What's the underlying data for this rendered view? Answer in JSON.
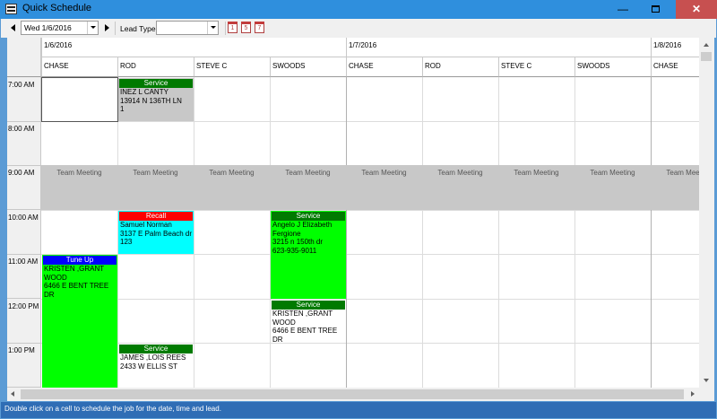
{
  "window": {
    "title": "Quick Schedule",
    "minimize_glyph": "—",
    "close_glyph": "✕"
  },
  "toolbar": {
    "date_value": "Wed 1/6/2016",
    "lead_type_label": "Lead Type",
    "lead_type_value": "",
    "view_buttons": [
      "1",
      "5",
      "7"
    ]
  },
  "dates": [
    "1/6/2016",
    "1/7/2016",
    "1/8/2016"
  ],
  "leads": [
    "CHASE",
    "ROD",
    "STEVE C",
    "SWOODS",
    "CHASE",
    "ROD",
    "STEVE C",
    "SWOODS",
    "CHASE"
  ],
  "times": [
    "7:00 AM",
    "8:00 AM",
    "9:00 AM",
    "10:00 AM",
    "11:00 AM",
    "12:00 PM",
    "1:00 PM"
  ],
  "meeting_label": "Team Meeting",
  "appointments": {
    "a1": {
      "type": "Service",
      "name": "INEZ L CANTY",
      "address": "13914 N 136TH LN",
      "extra": "1"
    },
    "a2": {
      "type": "Recall",
      "name": "Samuel Norman",
      "address": "3137 E Palm Beach dr",
      "extra": "123"
    },
    "a3": {
      "type": "Service",
      "name": "Angelo J Elizabeth Fergione",
      "address": "3215 n 150th dr",
      "extra": "623-935-9011"
    },
    "a4": {
      "type": "Tune Up",
      "name": "KRISTEN ,GRANT WOOD",
      "address": "6466 E BENT TREE DR",
      "extra": ""
    },
    "a5": {
      "type": "Service",
      "name": "KRISTEN ,GRANT WOOD",
      "address": "6466 E BENT TREE DR",
      "extra": ""
    },
    "a6": {
      "type": "Service",
      "name": "JAMES ,LOIS REES",
      "address": "2433 W ELLIS ST",
      "extra": ""
    }
  },
  "colors": {
    "service_bar": "#007a00",
    "recall_bar": "#ff0000",
    "tuneup_bar": "#0000ff",
    "green_fill": "#00ff00",
    "cyan_fill": "#00ffff",
    "gray_fill": "#c8c8c8"
  },
  "status": {
    "text": "Double click on a cell to schedule the job for the date, time and lead."
  }
}
